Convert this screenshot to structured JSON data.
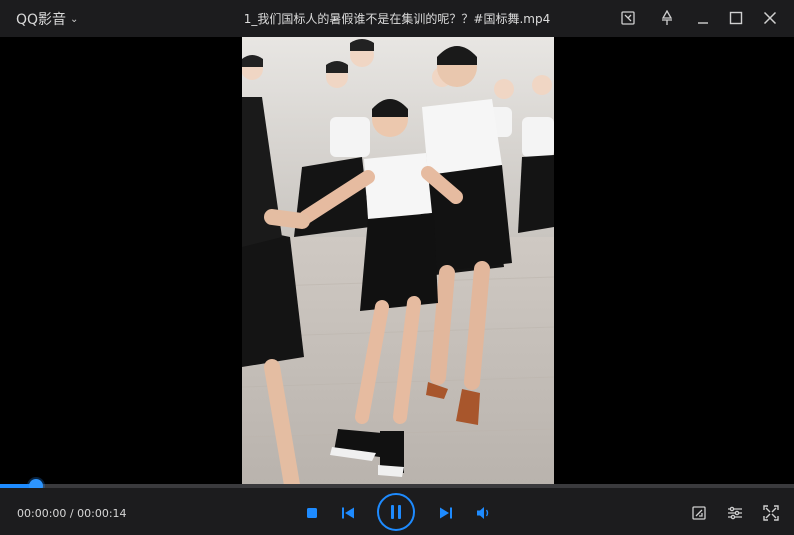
{
  "app": {
    "name": "QQ影音"
  },
  "window": {
    "title": "1_我们国标人的暑假谁不是在集训的呢？？#国标舞.mp4"
  },
  "playback": {
    "current_time": "00:00:00",
    "separator": "/",
    "duration": "00:00:14",
    "progress_fraction": 0.045
  },
  "colors": {
    "accent": "#1e8bff",
    "titlebar_bg": "#1c1c1e",
    "controls_bg": "#1c1c1e",
    "icon": "#d0d0d0"
  },
  "icons": {
    "titlebar": [
      "screenshot-icon",
      "pin-icon",
      "minimize-icon",
      "maximize-icon",
      "close-icon"
    ],
    "controls": [
      "stop-icon",
      "previous-icon",
      "pause-icon",
      "next-icon",
      "volume-icon",
      "screenshot-tool-icon",
      "settings-sliders-icon",
      "fullscreen-icon"
    ]
  }
}
